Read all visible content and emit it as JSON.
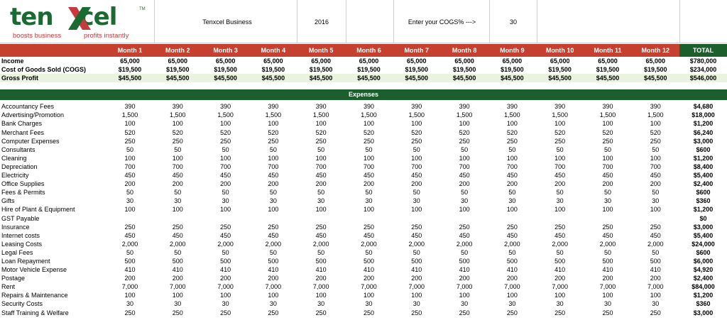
{
  "logo": {
    "word_left": "ten",
    "word_right": "cel",
    "tagline_left": "boosts business",
    "tagline_right": "profits instantly",
    "trademark": "TM"
  },
  "header": {
    "business": "Tenxcel Business",
    "year": "2016",
    "cogs_prompt": "Enter your COGS% --->",
    "cogs_value": "30"
  },
  "months": [
    "Month 1",
    "Month 2",
    "Month 3",
    "Month 4",
    "Month 5",
    "Month 6",
    "Month 7",
    "Month 8",
    "Month 9",
    "Month 10",
    "Month 11",
    "Month 12"
  ],
  "total_label": "TOTAL",
  "summary": [
    {
      "label": "Income",
      "values": [
        "65,000",
        "65,000",
        "65,000",
        "65,000",
        "65,000",
        "65,000",
        "65,000",
        "65,000",
        "65,000",
        "65,000",
        "65,000",
        "65,000"
      ],
      "total": "$780,000"
    },
    {
      "label": "Cost of Goods Sold  (COGS)",
      "values": [
        "$19,500",
        "$19,500",
        "$19,500",
        "$19,500",
        "$19,500",
        "$19,500",
        "$19,500",
        "$19,500",
        "$19,500",
        "$19,500",
        "$19,500",
        "$19,500"
      ],
      "total": "$234,000"
    },
    {
      "label": "Gross Profit",
      "values": [
        "$45,500",
        "$45,500",
        "$45,500",
        "$45,500",
        "$45,500",
        "$45,500",
        "$45,500",
        "$45,500",
        "$45,500",
        "$45,500",
        "$45,500",
        "$45,500"
      ],
      "total": "$546,000"
    }
  ],
  "expenses_title": "Expenses",
  "expenses": [
    {
      "label": "Accountancy Fees",
      "value": "390",
      "total": "$4,680"
    },
    {
      "label": "Advertising/Promotion",
      "value": "1,500",
      "total": "$18,000"
    },
    {
      "label": "Bank Charges",
      "value": "100",
      "total": "$1,200"
    },
    {
      "label": "Merchant Fees",
      "value": "520",
      "total": "$6,240"
    },
    {
      "label": "Computer Expenses",
      "value": "250",
      "total": "$3,000"
    },
    {
      "label": "Consultants",
      "value": "50",
      "total": "$600"
    },
    {
      "label": "Cleaning",
      "value": "100",
      "total": "$1,200"
    },
    {
      "label": "Depreciation",
      "value": "700",
      "total": "$8,400"
    },
    {
      "label": "Electricity",
      "value": "450",
      "total": "$5,400"
    },
    {
      "label": "Office Supplies",
      "value": "200",
      "total": "$2,400"
    },
    {
      "label": "Fees & Permits",
      "value": "50",
      "total": "$600"
    },
    {
      "label": "Gifts",
      "value": "30",
      "total": "$360"
    },
    {
      "label": "Hire of Plant & Equipment",
      "value": "100",
      "total": "$1,200"
    },
    {
      "label": "GST Payable",
      "value": "",
      "total": "$0"
    },
    {
      "label": "Insurance",
      "value": "250",
      "total": "$3,000"
    },
    {
      "label": "Internet costs",
      "value": "450",
      "total": "$5,400"
    },
    {
      "label": "Leasing Costs",
      "value": "2,000",
      "total": "$24,000"
    },
    {
      "label": "Legal Fees",
      "value": "50",
      "total": "$600"
    },
    {
      "label": "Loan Repayment",
      "value": "500",
      "total": "$6,000"
    },
    {
      "label": "Motor Vehicle Expense",
      "value": "410",
      "total": "$4,920"
    },
    {
      "label": "Postage",
      "value": "200",
      "total": "$2,400"
    },
    {
      "label": "Rent",
      "value": "7,000",
      "total": "$84,000"
    },
    {
      "label": "Repairs & Maintenance",
      "value": "100",
      "total": "$1,200"
    },
    {
      "label": "Security Costs",
      "value": "30",
      "total": "$360"
    },
    {
      "label": "Staff Training & Welfare",
      "value": "250",
      "total": "$3,000"
    }
  ],
  "colors": {
    "month_header": "#c5402f",
    "total_header": "#1d5e2d",
    "expenses_header": "#1d5e2d",
    "gross_profit_row": "#e9f3dd",
    "logo_green": "#1a6b31",
    "logo_red": "#c8393b"
  }
}
